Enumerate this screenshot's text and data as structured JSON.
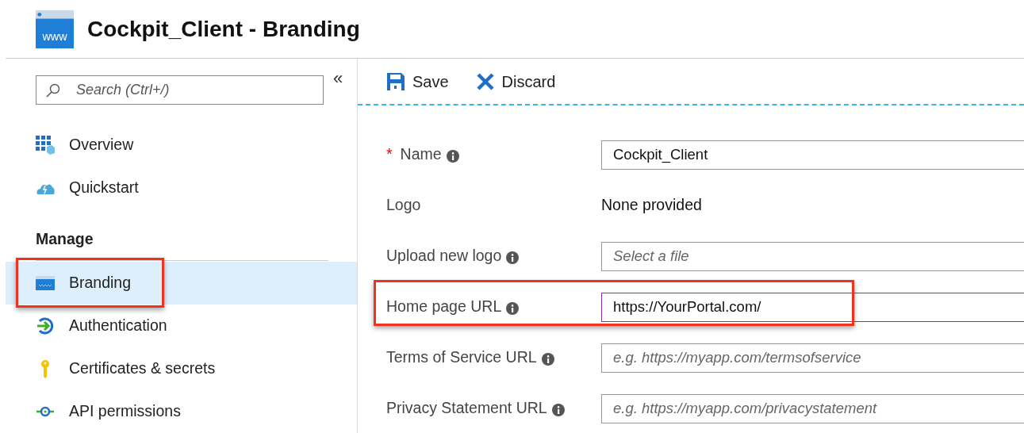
{
  "header": {
    "title": "Cockpit_Client - Branding",
    "icon_text": "www"
  },
  "sidebar": {
    "search": {
      "placeholder": "Search (Ctrl+/)"
    },
    "collapse": "«",
    "items": [
      {
        "kind": "link",
        "label": "Overview",
        "selected": false,
        "highlighted": false
      },
      {
        "kind": "link",
        "label": "Quickstart",
        "selected": false,
        "highlighted": false
      },
      {
        "kind": "heading",
        "label": "Manage"
      },
      {
        "kind": "link",
        "label": "Branding",
        "selected": true,
        "highlighted": true
      },
      {
        "kind": "link",
        "label": "Authentication",
        "selected": false,
        "highlighted": false
      },
      {
        "kind": "link",
        "label": "Certificates & secrets",
        "selected": false,
        "highlighted": false
      },
      {
        "kind": "link",
        "label": "API permissions",
        "selected": false,
        "highlighted": false
      }
    ]
  },
  "toolbar": [
    {
      "kind": "save",
      "label": "Save"
    },
    {
      "kind": "discard",
      "label": "Discard"
    }
  ],
  "form": [
    {
      "kind": "input",
      "label": "Name",
      "required_mark": "*",
      "info": true,
      "value": "Cockpit_Client",
      "focused": false,
      "highlighted": false
    },
    {
      "kind": "text",
      "label": "Logo",
      "info": false,
      "value": "None provided"
    },
    {
      "kind": "input",
      "label": "Upload new logo",
      "info": true,
      "placeholder": "Select a file",
      "focused": false,
      "highlighted": false
    },
    {
      "kind": "input",
      "label": "Home page URL",
      "info": true,
      "value": "https://YourPortal.com/",
      "focused": true,
      "highlighted": true
    },
    {
      "kind": "input",
      "label": "Terms of Service URL",
      "info": true,
      "placeholder": "e.g. https://myapp.com/termsofservice",
      "focused": false,
      "highlighted": false
    },
    {
      "kind": "input",
      "label": "Privacy Statement URL",
      "info": true,
      "placeholder": "e.g. https://myapp.com/privacystatement",
      "focused": false,
      "highlighted": false
    }
  ]
}
